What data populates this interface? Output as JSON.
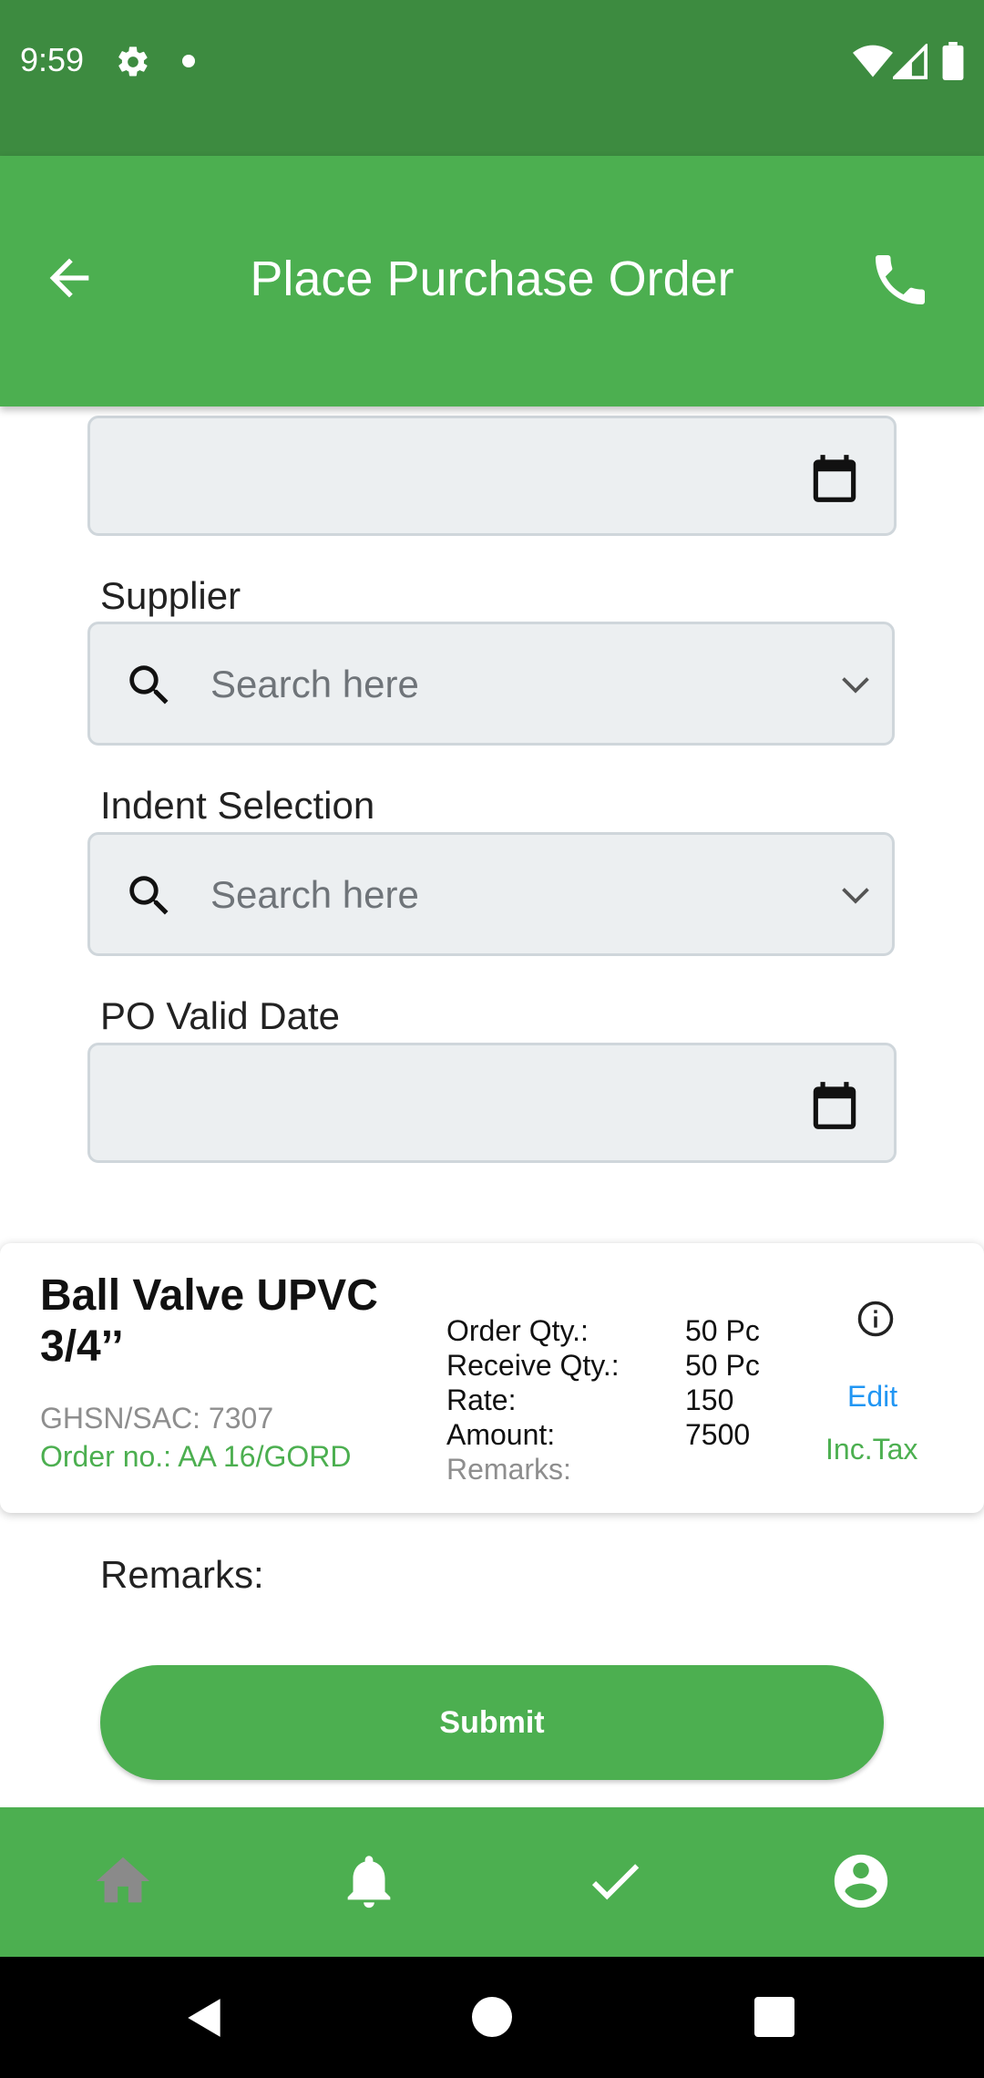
{
  "status_bar": {
    "time": "9:59",
    "icons": [
      "gear-icon",
      "notification-dot",
      "wifi-icon",
      "signal-icon",
      "battery-icon"
    ]
  },
  "app_bar": {
    "title": "Place Purchase Order",
    "back_icon": "arrow-back-icon",
    "action_icon": "phone-icon",
    "color": "#4caf50"
  },
  "form": {
    "supplier": {
      "label": "Supplier",
      "placeholder": "Search here"
    },
    "indent_selection": {
      "label": "Indent Selection",
      "placeholder": "Search here"
    },
    "po_valid_date": {
      "label": "PO Valid Date"
    }
  },
  "item_card": {
    "name": "Ball Valve UPVC 3/4’’",
    "hsn": "GHSN/SAC: 7307",
    "order_no": "Order no.: AA 16/GORD",
    "details": [
      {
        "label": "Order Qty.:",
        "value": "50 Pc"
      },
      {
        "label": "Receive Qty.:",
        "value": "50 Pc"
      },
      {
        "label": "Rate:",
        "value": "150"
      },
      {
        "label": "Amount:",
        "value": "7500"
      }
    ],
    "remarks_label": "Remarks:",
    "edit_label": "Edit",
    "inc_tax_label": "Inc.Tax"
  },
  "remarks": {
    "label": "Remarks:"
  },
  "submit_label": "Submit",
  "bottom_nav": {
    "items": [
      "home-icon",
      "bell-icon",
      "check-icon",
      "account-icon"
    ]
  },
  "colors": {
    "primary": "#4caf50",
    "status_bar": "#3d8b40",
    "link": "#2196f3"
  }
}
